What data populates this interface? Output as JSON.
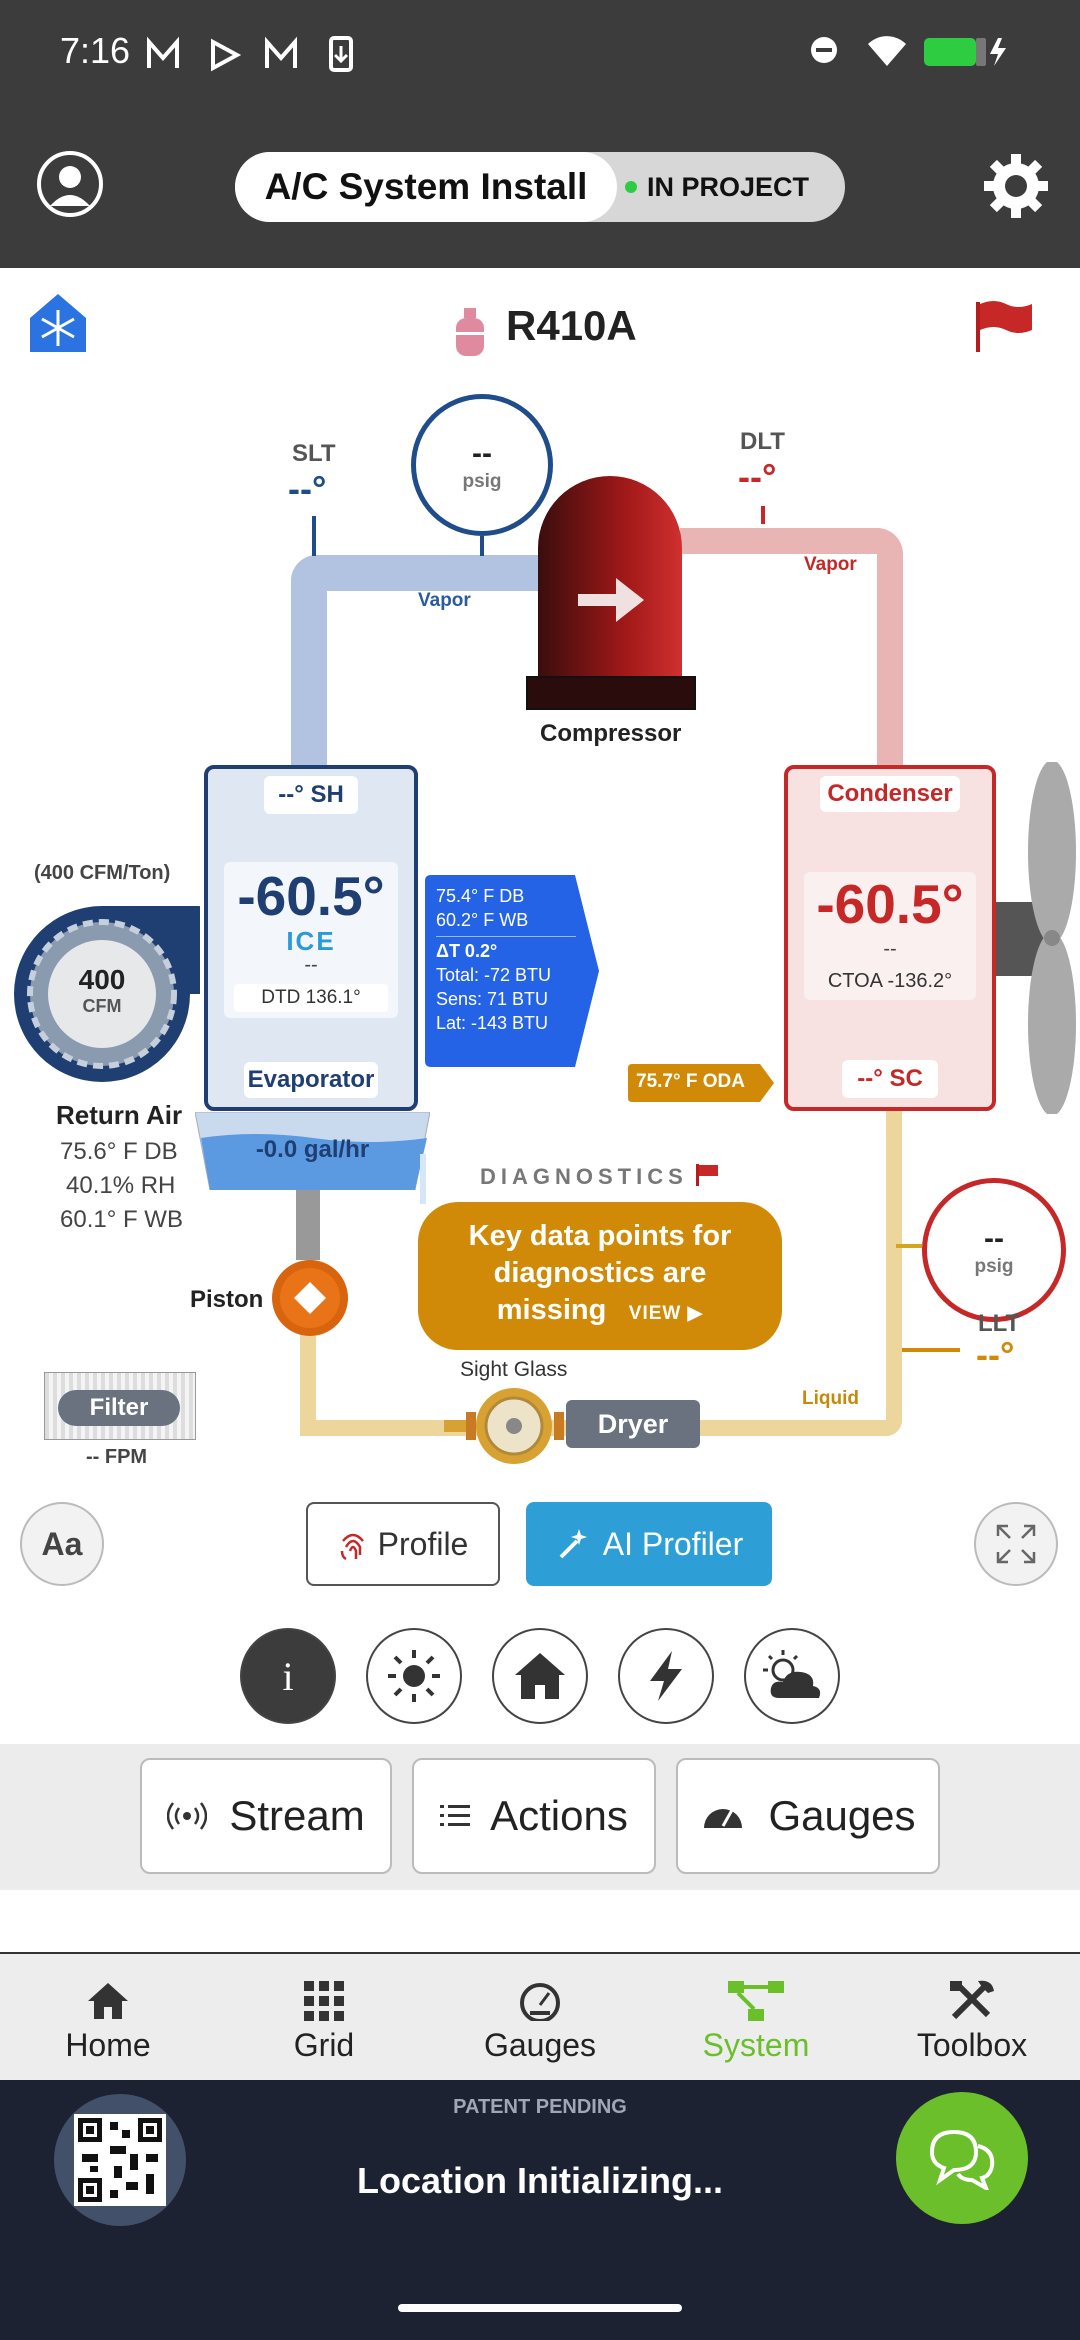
{
  "status_bar": {
    "time": "7:16"
  },
  "header": {
    "title": "A/C System Install",
    "status": "IN PROJECT"
  },
  "refrigerant": "R410A",
  "suction": {
    "label": "SLT",
    "temp": "--°",
    "pressure": "--",
    "pressure_unit": "psig",
    "vapor": "Vapor"
  },
  "discharge": {
    "label": "DLT",
    "temp": "--°",
    "vapor": "Vapor"
  },
  "compressor": {
    "label": "Compressor"
  },
  "evaporator": {
    "sh": "--° SH",
    "temp": "-60.5°",
    "state": "ICE",
    "dash": "--",
    "dtd": "DTD 136.1°",
    "label": "Evaporator",
    "drain": "-0.0 gal/hr"
  },
  "info_box": {
    "db": "75.4° F DB",
    "wb": "60.2° F WB",
    "dt": "ΔT 0.2°",
    "total": "Total: -72 BTU",
    "sens": "Sens: 71 BTU",
    "lat": "Lat: -143 BTU"
  },
  "condenser": {
    "label": "Condenser",
    "temp": "-60.5°",
    "dash": "--",
    "ctoa": "CTOA -136.2°",
    "sc": "--° SC",
    "oda": "75.7° F ODA"
  },
  "blower": {
    "ratio": "(400 CFM/Ton)",
    "cfm": "400",
    "unit": "CFM"
  },
  "return_air": {
    "title": "Return Air",
    "db": "75.6° F DB",
    "rh": "40.1% RH",
    "wb": "60.1° F WB"
  },
  "filter": {
    "label": "Filter",
    "fpm": "-- FPM"
  },
  "piston": {
    "label": "Piston"
  },
  "diagnostics": {
    "title": "DIAGNOSTICS",
    "message_l1": "Key data points for",
    "message_l2": "diagnostics are",
    "message_l3": "missing",
    "view": "VIEW ▶"
  },
  "liquid": {
    "pressure": "--",
    "pressure_unit": "psig",
    "llt_label": "LLT",
    "llt_temp": "--°",
    "liquid": "Liquid"
  },
  "sight_glass": {
    "label": "Sight Glass"
  },
  "dryer": {
    "label": "Dryer"
  },
  "controls": {
    "font_btn": "Aa",
    "profile": "Profile",
    "ai_profiler": "AI Profiler"
  },
  "tabs": {
    "stream": "Stream",
    "actions": "Actions",
    "gauges": "Gauges"
  },
  "nav": [
    {
      "label": "Home"
    },
    {
      "label": "Grid"
    },
    {
      "label": "Gauges"
    },
    {
      "label": "System"
    },
    {
      "label": "Toolbox"
    }
  ],
  "footer": {
    "patent": "PATENT PENDING",
    "location": "Location Initializing..."
  },
  "colors": {
    "accent_green": "#6bbf2a",
    "blue": "#1f4d8c",
    "red": "#c62828",
    "amber": "#d08a07",
    "bg_dark": "#3c3c3c",
    "footer_dark": "#1d2232"
  }
}
